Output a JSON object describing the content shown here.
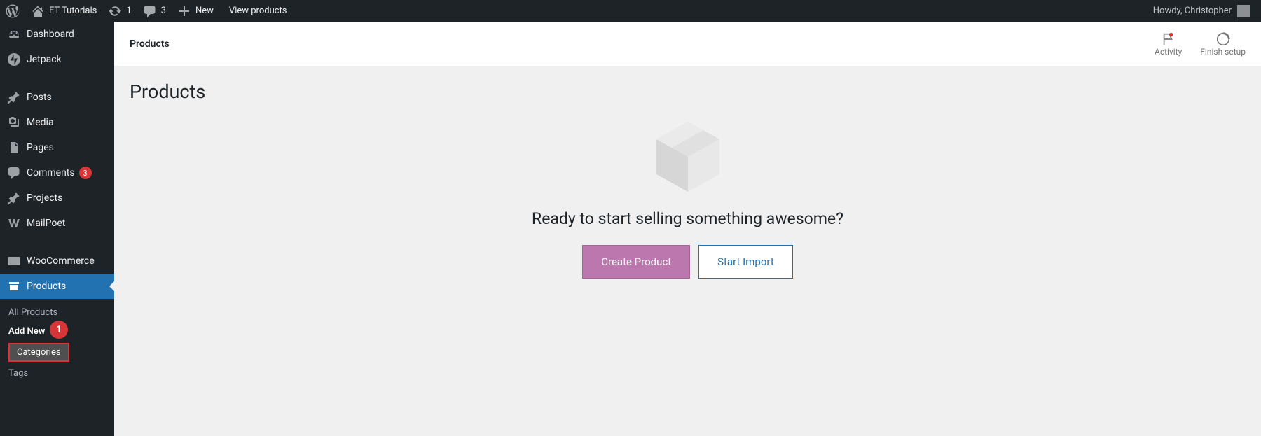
{
  "adminbar": {
    "site_name": "ET Tutorials",
    "updates_count": "1",
    "comments_count": "3",
    "new_label": "New",
    "view_products_label": "View products",
    "howdy": "Howdy, Christopher"
  },
  "sidebar": {
    "dashboard": "Dashboard",
    "jetpack": "Jetpack",
    "posts": "Posts",
    "media": "Media",
    "pages": "Pages",
    "comments": "Comments",
    "comments_badge": "3",
    "projects": "Projects",
    "mailpoet": "MailPoet",
    "woocommerce": "WooCommerce",
    "products": "Products",
    "submenu": {
      "all_products": "All Products",
      "add_new": "Add New",
      "categories": "Categories",
      "tags": "Tags"
    },
    "callout_number": "1"
  },
  "header": {
    "title": "Products",
    "activity": "Activity",
    "finish_setup": "Finish setup"
  },
  "page": {
    "heading": "Products",
    "empty_heading": "Ready to start selling something awesome?",
    "create_button": "Create Product",
    "import_button": "Start Import"
  }
}
